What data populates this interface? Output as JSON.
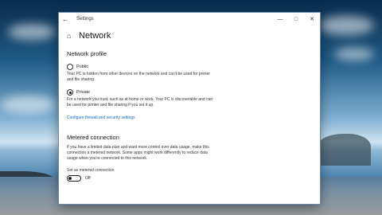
{
  "window": {
    "title": "Settings",
    "back_icon": "back-arrow-icon",
    "controls": [
      "minimize-icon",
      "maximize-icon",
      "close-icon"
    ]
  },
  "page": {
    "title": "Network",
    "home_icon": "home-icon"
  },
  "network_profile": {
    "heading": "Network profile",
    "public": {
      "label": "Public",
      "selected": false,
      "description": "Your PC is hidden from other devices on the network and can't be used for printer and file sharing."
    },
    "private": {
      "label": "Private",
      "selected": true,
      "description": "For a network you trust, such as at home or work. Your PC is discoverable and can be used for printer and file sharing if you set it up."
    },
    "link": "Configure firewall and security settings"
  },
  "metered": {
    "heading": "Metered connection",
    "description": "If you have a limited data plan and want more control over data usage, make this connection a metered network. Some apps might work differently to reduce data usage when you're connected to this network.",
    "toggle_label": "Set as metered connection",
    "toggle_state": "Off",
    "toggle_on": false
  }
}
